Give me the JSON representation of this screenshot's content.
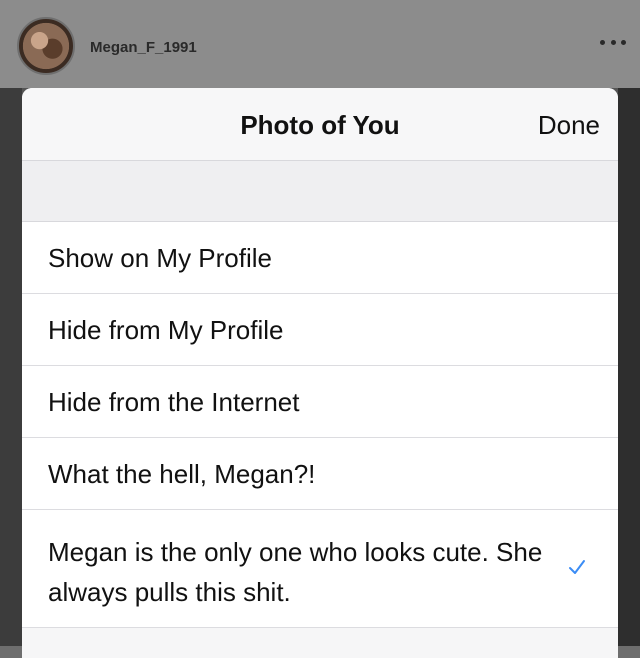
{
  "post": {
    "username": "Megan_F_1991"
  },
  "sheet": {
    "title": "Photo of You",
    "done_label": "Done",
    "options": [
      {
        "label": "Show on My Profile",
        "selected": false
      },
      {
        "label": "Hide from My Profile",
        "selected": false
      },
      {
        "label": "Hide from the Internet",
        "selected": false
      },
      {
        "label": "What the hell, Megan?!",
        "selected": false
      },
      {
        "label": "Megan is the only one who looks cute. She always pulls this shit.",
        "selected": true
      }
    ]
  },
  "colors": {
    "checkmark": "#3b8cf5"
  }
}
